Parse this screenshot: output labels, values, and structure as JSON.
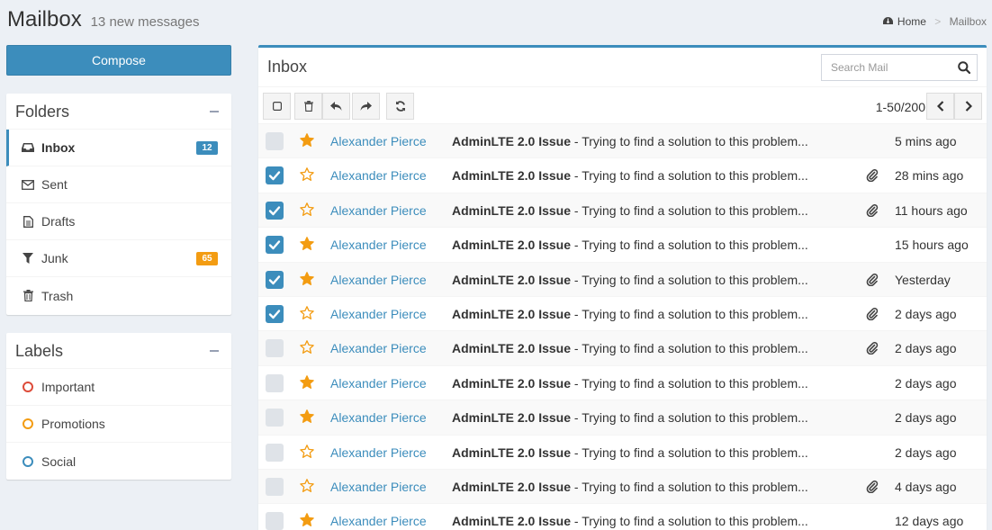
{
  "header": {
    "title": "Mailbox",
    "subtitle": "13 new messages",
    "breadcrumb": {
      "home": "Home",
      "current": "Mailbox"
    }
  },
  "compose_label": "Compose",
  "folders": {
    "title": "Folders",
    "items": [
      {
        "label": "Inbox",
        "icon": "inbox-icon",
        "badge": "12",
        "badge_color": "#3c8dbc"
      },
      {
        "label": "Sent",
        "icon": "envelope-icon"
      },
      {
        "label": "Drafts",
        "icon": "file-icon"
      },
      {
        "label": "Junk",
        "icon": "filter-icon",
        "badge": "65",
        "badge_color": "#f39c12"
      },
      {
        "label": "Trash",
        "icon": "trash-icon"
      }
    ]
  },
  "labels": {
    "title": "Labels",
    "items": [
      {
        "label": "Important",
        "color": "#dd4b39"
      },
      {
        "label": "Promotions",
        "color": "#f39c12"
      },
      {
        "label": "Social",
        "color": "#3c8dbc"
      }
    ]
  },
  "inbox": {
    "title": "Inbox",
    "search_placeholder": "Search Mail",
    "pager": "1-50/200"
  },
  "messages": [
    {
      "checked": false,
      "starred": true,
      "sender": "Alexander Pierce",
      "subject": "AdminLTE 2.0 Issue",
      "preview": " - Trying to find a solution to this problem...",
      "attachment": false,
      "date": "5 mins ago"
    },
    {
      "checked": true,
      "starred": false,
      "sender": "Alexander Pierce",
      "subject": "AdminLTE 2.0 Issue",
      "preview": " - Trying to find a solution to this problem...",
      "attachment": true,
      "date": "28 mins ago"
    },
    {
      "checked": true,
      "starred": false,
      "sender": "Alexander Pierce",
      "subject": "AdminLTE 2.0 Issue",
      "preview": " - Trying to find a solution to this problem...",
      "attachment": true,
      "date": "11 hours ago"
    },
    {
      "checked": true,
      "starred": true,
      "sender": "Alexander Pierce",
      "subject": "AdminLTE 2.0 Issue",
      "preview": " - Trying to find a solution to this problem...",
      "attachment": false,
      "date": "15 hours ago"
    },
    {
      "checked": true,
      "starred": true,
      "sender": "Alexander Pierce",
      "subject": "AdminLTE 2.0 Issue",
      "preview": " - Trying to find a solution to this problem...",
      "attachment": true,
      "date": "Yesterday"
    },
    {
      "checked": true,
      "starred": false,
      "sender": "Alexander Pierce",
      "subject": "AdminLTE 2.0 Issue",
      "preview": " - Trying to find a solution to this problem...",
      "attachment": true,
      "date": "2 days ago"
    },
    {
      "checked": false,
      "starred": false,
      "sender": "Alexander Pierce",
      "subject": "AdminLTE 2.0 Issue",
      "preview": " - Trying to find a solution to this problem...",
      "attachment": true,
      "date": "2 days ago"
    },
    {
      "checked": false,
      "starred": true,
      "sender": "Alexander Pierce",
      "subject": "AdminLTE 2.0 Issue",
      "preview": " - Trying to find a solution to this problem...",
      "attachment": false,
      "date": "2 days ago"
    },
    {
      "checked": false,
      "starred": true,
      "sender": "Alexander Pierce",
      "subject": "AdminLTE 2.0 Issue",
      "preview": " - Trying to find a solution to this problem...",
      "attachment": false,
      "date": "2 days ago"
    },
    {
      "checked": false,
      "starred": false,
      "sender": "Alexander Pierce",
      "subject": "AdminLTE 2.0 Issue",
      "preview": " - Trying to find a solution to this problem...",
      "attachment": false,
      "date": "2 days ago"
    },
    {
      "checked": false,
      "starred": false,
      "sender": "Alexander Pierce",
      "subject": "AdminLTE 2.0 Issue",
      "preview": " - Trying to find a solution to this problem...",
      "attachment": true,
      "date": "4 days ago"
    },
    {
      "checked": false,
      "starred": true,
      "sender": "Alexander Pierce",
      "subject": "AdminLTE 2.0 Issue",
      "preview": " - Trying to find a solution to this problem...",
      "attachment": false,
      "date": "12 days ago"
    }
  ]
}
